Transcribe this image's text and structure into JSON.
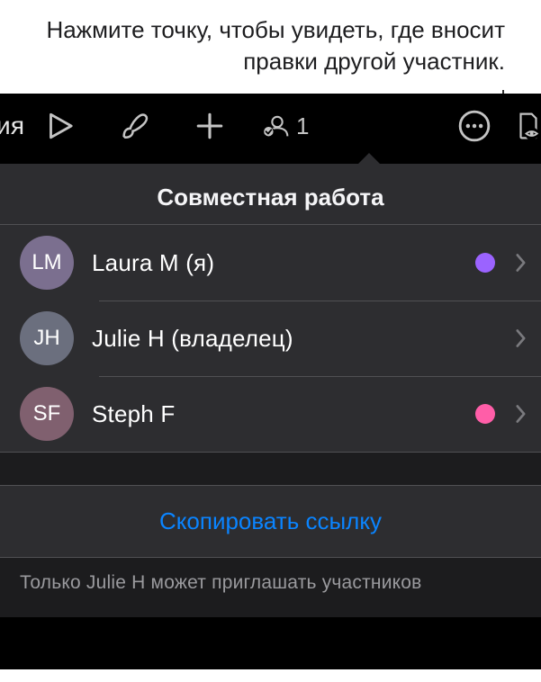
{
  "annotation": "Нажмите точку, чтобы увидеть, где вносит правки другой участник.",
  "toolbar": {
    "fragment": "ация",
    "collab_count": "1"
  },
  "popover": {
    "title": "Совместная работа",
    "participants": [
      {
        "initials": "LM",
        "name": "Laura M (я)",
        "avatar_bg": "#7b6f8f",
        "dot": "#9b63ff"
      },
      {
        "initials": "JH",
        "name": "Julie H (владелец)",
        "avatar_bg": "#6b6f7e",
        "dot": null
      },
      {
        "initials": "SF",
        "name": "Steph F",
        "avatar_bg": "#80606f",
        "dot": "#ff5ea8"
      }
    ],
    "copy_link": "Скопировать ссылку",
    "footer": "Только Julie H может приглашать участников"
  }
}
